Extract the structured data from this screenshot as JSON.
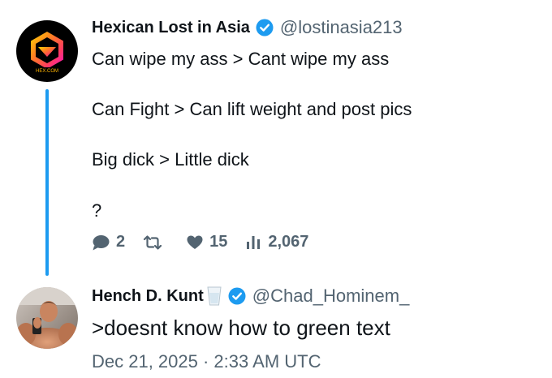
{
  "tweet1": {
    "author_name": "Hexican Lost in Asia",
    "handle": "@lostinasia213",
    "avatar_icon": "hex-logo-icon",
    "avatar_text": "HEX.COM",
    "lines": [
      "Can wipe my ass > Cant wipe my ass",
      "Can Fight > Can lift weight and post pics",
      "Big dick > Little dick",
      "?"
    ],
    "actions": {
      "replies": "2",
      "retweets": "",
      "likes": "15",
      "views": "2,067"
    }
  },
  "tweet2": {
    "author_name": "Hench D. Kunt",
    "handle": "@Chad_Hominem_",
    "avatar_icon": "muscular-man-avatar",
    "text": ">doesnt know how to green text",
    "timestamp": "Dec 21, 2025 · 2:33 AM UTC"
  },
  "colors": {
    "accent": "#1d9bf0",
    "muted": "#536471",
    "text": "#0f1419"
  }
}
